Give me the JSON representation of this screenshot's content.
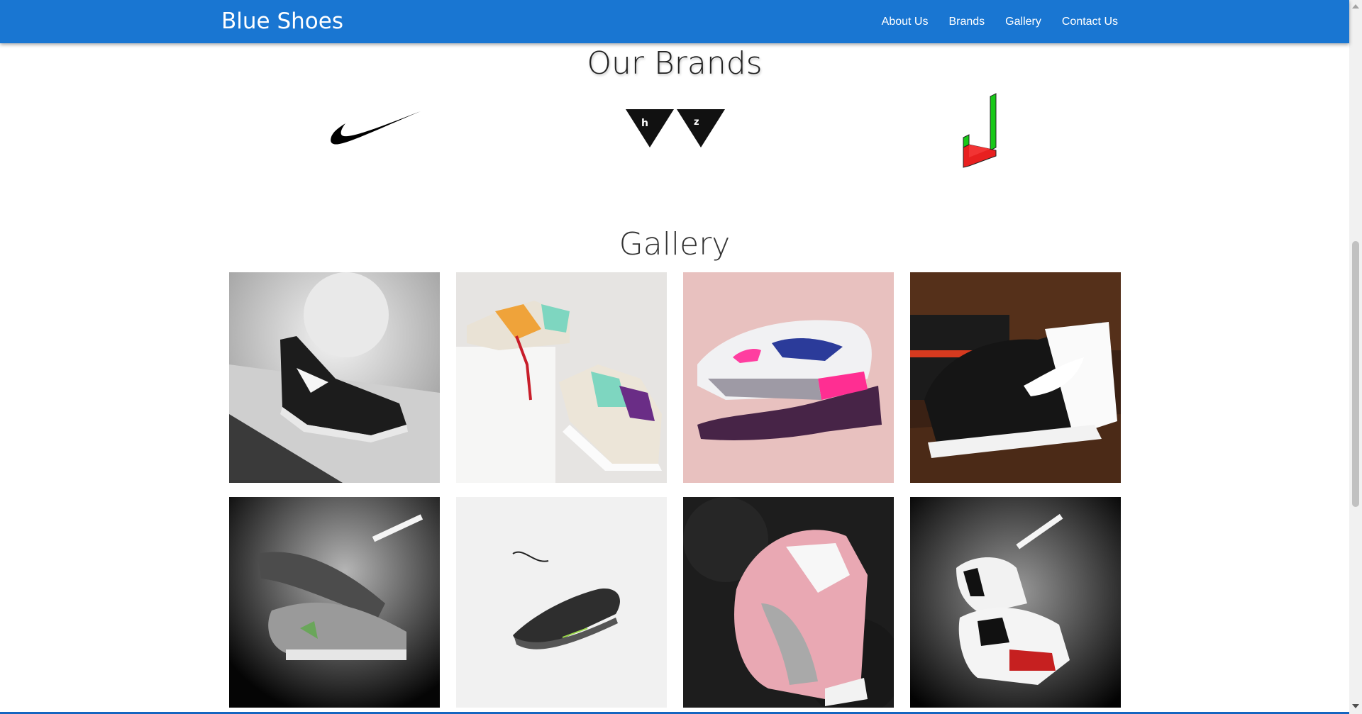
{
  "navbar": {
    "brand": "Blue Shoes",
    "links": [
      "About Us",
      "Brands",
      "Gallery",
      "Contact Us"
    ]
  },
  "brands": {
    "title": "Our Brands",
    "logos": [
      "swoosh-logo",
      "triangles-logo",
      "stripes-logo"
    ]
  },
  "gallery": {
    "title": "Gallery",
    "images": [
      {
        "icon": "black-sneaker-on-shelf-photo"
      },
      {
        "icon": "colorful-sneakers-on-block-photo"
      },
      {
        "icon": "pink-sneaker-on-hand-photo"
      },
      {
        "icon": "black-white-sneaker-with-book-photo"
      },
      {
        "icon": "grey-sneakers-spotlight-photo"
      },
      {
        "icon": "floating-black-sneaker-photo"
      },
      {
        "icon": "pink-sneaker-on-fur-photo"
      },
      {
        "icon": "white-high-top-spotlight-photo"
      }
    ]
  },
  "colors": {
    "primary": "#1976d2",
    "text": "#212121"
  }
}
